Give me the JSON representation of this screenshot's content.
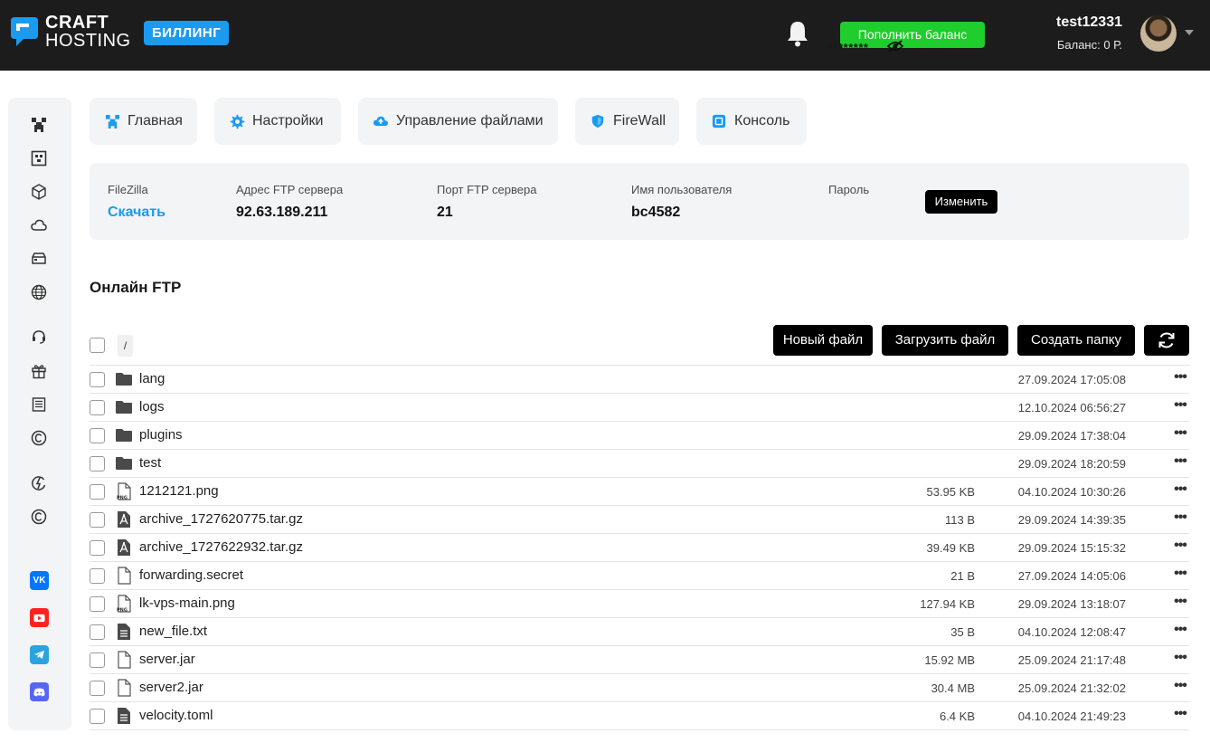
{
  "header": {
    "logo_line1": "CRAFT",
    "logo_line2": "HOSTING",
    "billing_badge": "БИЛЛИНГ",
    "topup_label": "Пополнить баланс",
    "username": "test12331",
    "balance": "Баланс: 0 Р."
  },
  "sidebar": {
    "icons": [
      "minecraft-icon",
      "server-grid-icon",
      "cube-icon",
      "cloud-icon",
      "storage-icon",
      "globe-icon",
      "headset-icon",
      "gift-icon",
      "document-list-icon",
      "copyright-icon",
      "power-swap-icon",
      "copyright-icon"
    ],
    "socials": [
      {
        "name": "vk-icon",
        "label": "VK",
        "color": "#0077ff"
      },
      {
        "name": "youtube-icon",
        "label": "▶",
        "color": "#ff2020"
      },
      {
        "name": "telegram-icon",
        "label": "➤",
        "color": "#2aa3e0"
      },
      {
        "name": "discord-icon",
        "label": "◉",
        "color": "#5865f2"
      }
    ]
  },
  "tabs": [
    {
      "label": "Главная",
      "icon": "minecraft-icon"
    },
    {
      "label": "Настройки",
      "icon": "gear-icon"
    },
    {
      "label": "Управление файлами",
      "icon": "cloud-files-icon"
    },
    {
      "label": "FireWall",
      "icon": "shield-icon"
    },
    {
      "label": "Консоль",
      "icon": "console-icon"
    }
  ],
  "ftp": {
    "filezilla_label": "FileZilla",
    "filezilla_link": "Скачать",
    "address_label": "Адрес FTP сервера",
    "address_value": "92.63.189.211",
    "port_label": "Порт FTP сервера",
    "port_value": "21",
    "user_label": "Имя пользователя",
    "user_value": "bc4582",
    "password_label": "Пароль",
    "password_value": "********",
    "change_label": "Изменить"
  },
  "online_ftp": {
    "title": "Онлайн FTP",
    "path": "/",
    "new_file": "Новый файл",
    "upload_file": "Загрузить файл",
    "create_folder": "Создать папку"
  },
  "files": [
    {
      "name": "lang",
      "type": "folder",
      "size": "",
      "date": "27.09.2024 17:05:08"
    },
    {
      "name": "logs",
      "type": "folder",
      "size": "",
      "date": "12.10.2024 06:56:27"
    },
    {
      "name": "plugins",
      "type": "folder",
      "size": "",
      "date": "29.09.2024 17:38:04"
    },
    {
      "name": "test",
      "type": "folder",
      "size": "",
      "date": "29.09.2024 18:20:59"
    },
    {
      "name": "1212121.png",
      "type": "png",
      "size": "53.95 KB",
      "date": "04.10.2024 10:30:26"
    },
    {
      "name": "archive_1727620775.tar.gz",
      "type": "archive",
      "size": "113 B",
      "date": "29.09.2024 14:39:35"
    },
    {
      "name": "archive_1727622932.tar.gz",
      "type": "archive",
      "size": "39.49 KB",
      "date": "29.09.2024 15:15:32"
    },
    {
      "name": "forwarding.secret",
      "type": "file",
      "size": "21 B",
      "date": "27.09.2024 14:05:06"
    },
    {
      "name": "lk-vps-main.png",
      "type": "png",
      "size": "127.94 KB",
      "date": "29.09.2024 13:18:07"
    },
    {
      "name": "new_file.txt",
      "type": "text",
      "size": "35 B",
      "date": "04.10.2024 12:08:47"
    },
    {
      "name": "server.jar",
      "type": "file",
      "size": "15.92 MB",
      "date": "25.09.2024 21:17:48"
    },
    {
      "name": "server2.jar",
      "type": "file",
      "size": "30.4 MB",
      "date": "25.09.2024 21:32:02"
    },
    {
      "name": "velocity.toml",
      "type": "text",
      "size": "6.4 KB",
      "date": "04.10.2024 21:49:23"
    }
  ]
}
